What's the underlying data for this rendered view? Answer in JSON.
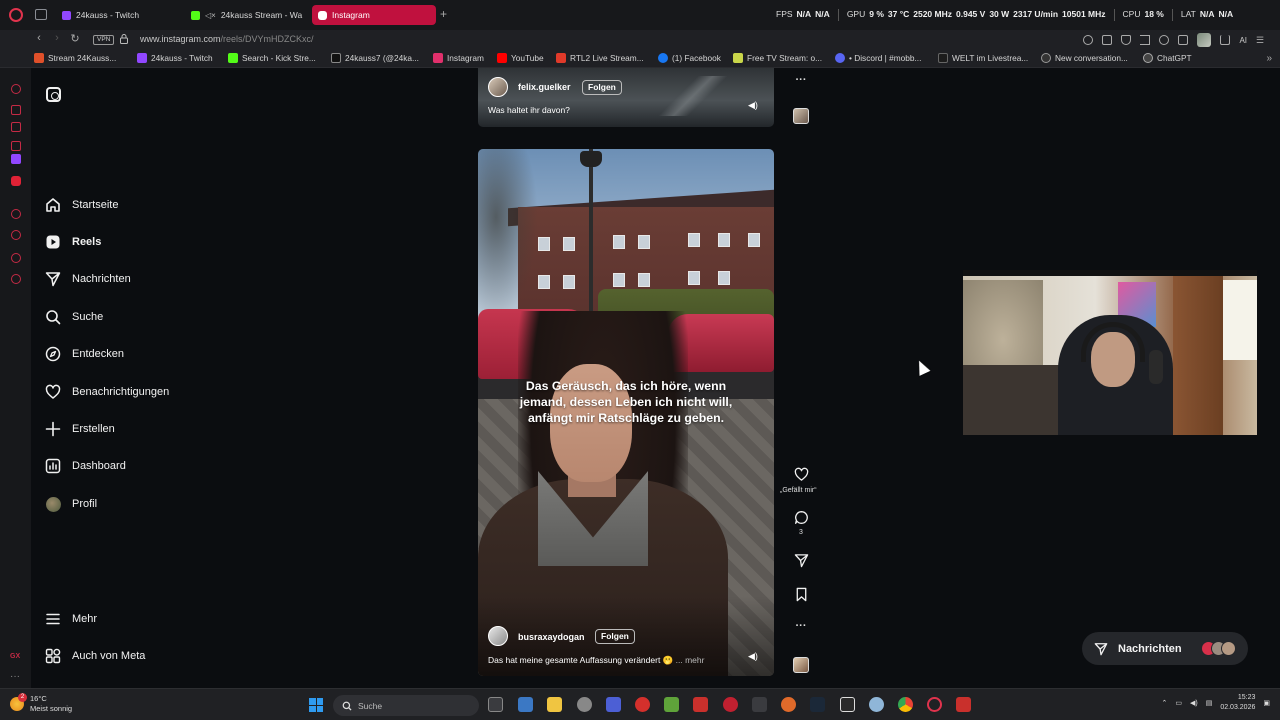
{
  "browser": {
    "tabs": [
      {
        "label": "24kauss - Twitch",
        "color": "#9147ff",
        "active": false
      },
      {
        "label": "24kauss Stream - Wa",
        "color": "#53fc18",
        "active": false,
        "muted": true
      },
      {
        "label": "Instagram",
        "color": "#e1306c",
        "active": true
      }
    ],
    "new_tab": "+",
    "stats": {
      "fps_label": "FPS",
      "fps": "N/A",
      "fps2": "N/A",
      "gpu_label": "GPU",
      "gpu_load": "9 %",
      "gpu_temp": "37 °C",
      "gpu_clock": "2520 MHz",
      "gpu_volt": "0.945 V",
      "gpu_power": "30 W",
      "gpu_fan": "2317 U/min",
      "gpu_mem": "10501 MHz",
      "cpu_label": "CPU",
      "cpu_load": "18 %",
      "lat_label": "LAT",
      "lat1": "N/A",
      "lat2": "N/A"
    },
    "vpn": "VPN",
    "url_host": "www.instagram.com",
    "url_path": "/reels/DVYmHDZCKxc/",
    "toolbar_ai": "AI",
    "bookmarks": [
      {
        "label": "Stream 24Kauss...",
        "color": "#e0502a"
      },
      {
        "label": "24kauss - Twitch",
        "color": "#9147ff"
      },
      {
        "label": "Search - Kick Stre...",
        "color": "#53fc18"
      },
      {
        "label": "24kauss7 (@24ka...",
        "color": "#111111"
      },
      {
        "label": "Instagram",
        "color": "#e1306c"
      },
      {
        "label": "YouTube",
        "color": "#ff0000"
      },
      {
        "label": "RTL2 Live Stream...",
        "color": "#e03a2a"
      },
      {
        "label": "(1) Facebook",
        "color": "#1877f2"
      },
      {
        "label": "Free TV Stream: o...",
        "color": "#c9d64a"
      },
      {
        "label": "• Discord | #mobb...",
        "color": "#5865f2"
      },
      {
        "label": "WELT im Livestrea...",
        "color": "#1c1c1c"
      },
      {
        "label": "New conversation...",
        "color": "#333333"
      },
      {
        "label": "ChatGPT",
        "color": "#444444"
      }
    ]
  },
  "instagram": {
    "nav": [
      {
        "label": "Startseite",
        "icon": "home-icon",
        "bold": false
      },
      {
        "label": "Reels",
        "icon": "reels-icon",
        "bold": true
      },
      {
        "label": "Nachrichten",
        "icon": "messages-icon",
        "bold": false
      },
      {
        "label": "Suche",
        "icon": "search-icon",
        "bold": false
      },
      {
        "label": "Entdecken",
        "icon": "explore-icon",
        "bold": false
      },
      {
        "label": "Benachrichtigungen",
        "icon": "heart-icon",
        "bold": false
      },
      {
        "label": "Erstellen",
        "icon": "plus-icon",
        "bold": false
      },
      {
        "label": "Dashboard",
        "icon": "dashboard-icon",
        "bold": false
      },
      {
        "label": "Profil",
        "icon": "avatar",
        "bold": false
      }
    ],
    "bottom_nav": [
      {
        "label": "Mehr",
        "icon": "menu-icon"
      },
      {
        "label": "Auch von Meta",
        "icon": "meta-icon"
      }
    ],
    "prev_reel": {
      "username": "felix.guelker",
      "follow": "Folgen",
      "caption": "Was haltet ihr davon?"
    },
    "reel": {
      "subtitle": "Das Geräusch, das ich höre, wenn jemand, dessen Leben ich nicht will, anfängt mir Ratschläge zu geben.",
      "username": "busraxaydogan",
      "follow": "Folgen",
      "caption": "Das hat meine gesamte Auffassung verändert",
      "caption_emoji": "🫢",
      "more": "... mehr",
      "like_label": "„Gefällt mir“",
      "comment_count": "3"
    },
    "messages_pill": "Nachrichten"
  },
  "taskbar": {
    "weather_temp": "16°C",
    "weather_desc": "Meist sonnig",
    "notification_count": "2",
    "search_placeholder": "Suche",
    "time": "15:23",
    "date": "02.03.2026"
  }
}
